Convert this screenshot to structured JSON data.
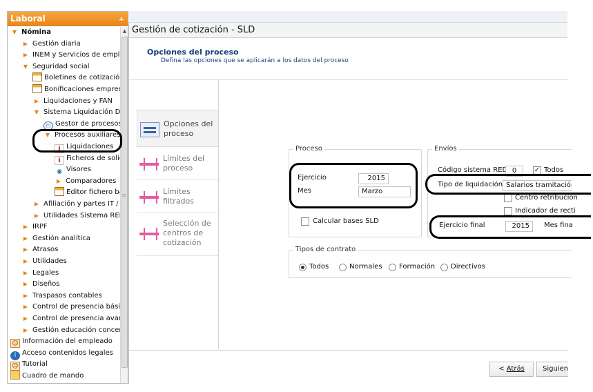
{
  "nav": {
    "title": "Laboral",
    "items": [
      {
        "label": "Nómina",
        "level": 0,
        "expander": "open",
        "icon": "",
        "bold": true
      },
      {
        "label": "Gestión diaria",
        "level": 1,
        "expander": "closed",
        "icon": ""
      },
      {
        "label": "INEM y Servicios de empleo",
        "level": 1,
        "expander": "closed",
        "icon": ""
      },
      {
        "label": "Seguridad social",
        "level": 1,
        "expander": "open",
        "icon": ""
      },
      {
        "label": "Boletines de cotización T",
        "level": 2,
        "expander": "",
        "icon": "grid"
      },
      {
        "label": "Bonificaciones empresa",
        "level": 2,
        "expander": "",
        "icon": "grid"
      },
      {
        "label": "Liquidaciones y FAN",
        "level": 2,
        "expander": "closed",
        "icon": ""
      },
      {
        "label": "Sistema Liquidación Dire",
        "level": 2,
        "expander": "open",
        "icon": ""
      },
      {
        "label": "Gestor de procesos",
        "level": 3,
        "expander": "",
        "icon": "clock"
      },
      {
        "label": "Procesos auxiliares",
        "level": 3,
        "expander": "open",
        "icon": ""
      },
      {
        "label": "Liquidaciones",
        "level": 4,
        "expander": "",
        "icon": "info"
      },
      {
        "label": "Ficheros de solic",
        "level": 4,
        "expander": "",
        "icon": "info"
      },
      {
        "label": "Visores",
        "level": 4,
        "expander": "",
        "icon": "eye"
      },
      {
        "label": "Comparadores",
        "level": 4,
        "expander": "closed",
        "icon": ""
      },
      {
        "label": "Editor fichero ba",
        "level": 4,
        "expander": "",
        "icon": "grid"
      },
      {
        "label": "Afiliación y partes IT / A",
        "level": 2,
        "expander": "closed",
        "icon": ""
      },
      {
        "label": "Utilidades Sistema RED",
        "level": 2,
        "expander": "closed",
        "icon": ""
      },
      {
        "label": "IRPF",
        "level": 1,
        "expander": "closed",
        "icon": ""
      },
      {
        "label": "Gestión analítica",
        "level": 1,
        "expander": "closed",
        "icon": ""
      },
      {
        "label": "Atrasos",
        "level": 1,
        "expander": "closed",
        "icon": ""
      },
      {
        "label": "Utilidades",
        "level": 1,
        "expander": "closed",
        "icon": ""
      },
      {
        "label": "Legales",
        "level": 1,
        "expander": "closed",
        "icon": ""
      },
      {
        "label": "Diseños",
        "level": 1,
        "expander": "closed",
        "icon": ""
      },
      {
        "label": "Traspasos contables",
        "level": 1,
        "expander": "closed",
        "icon": ""
      },
      {
        "label": "Control de presencia básico",
        "level": 1,
        "expander": "closed",
        "icon": ""
      },
      {
        "label": "Control de presencia avanza",
        "level": 1,
        "expander": "closed",
        "icon": ""
      },
      {
        "label": "Gestión educación concertad",
        "level": 1,
        "expander": "closed",
        "icon": ""
      },
      {
        "label": "Información del empleado",
        "level": 0,
        "expander": "",
        "icon": "user"
      },
      {
        "label": "Acceso contenidos legales",
        "level": 0,
        "expander": "",
        "icon": "world"
      },
      {
        "label": "Tutorial",
        "level": 0,
        "expander": "",
        "icon": "user"
      },
      {
        "label": "Cuadro de mando",
        "level": 0,
        "expander": "",
        "icon": "folder"
      }
    ]
  },
  "main": {
    "title": "Gestión de cotización - SLD",
    "heading": "Opciones del proceso",
    "subheading": "Defina las opciones que se aplicarán a los datos del proceso"
  },
  "steps": [
    {
      "label_1": "Opciones del",
      "label_2": "proceso",
      "label_3": "",
      "icon": "options-icon",
      "active": true
    },
    {
      "label_1": "Límites del",
      "label_2": "proceso",
      "label_3": "",
      "icon": "range-icon",
      "active": false
    },
    {
      "label_1": "Límites",
      "label_2": "filtrados",
      "label_3": "",
      "icon": "range-icon",
      "active": false
    },
    {
      "label_1": "Selección de",
      "label_2": "centros de",
      "label_3": "cotización",
      "icon": "range-icon",
      "active": false
    }
  ],
  "proceso": {
    "title": "Proceso",
    "ejercicio_label": "Ejercicio",
    "ejercicio_value": "2015",
    "mes_label": "Mes",
    "mes_value": "Marzo",
    "calcular_label": "Calcular bases SLD",
    "calcular_checked": false
  },
  "envios": {
    "title": "Envíos",
    "codigo_label": "Código sistema RED",
    "codigo_value": "0",
    "todos_label": "Todos",
    "todos_checked": true,
    "tipo_label": "Tipo de liquidación",
    "tipo_value": "Salarios tramitación",
    "centro_label": "Centro retribucion",
    "indicador_label": "Indicador de recti",
    "ejercicio_final_label": "Ejercicio final",
    "ejercicio_final_value": "2015",
    "mes_final_label": "Mes fina"
  },
  "tipos_contrato": {
    "title": "Tipos de contrato",
    "options": [
      "Todos",
      "Normales",
      "Formación",
      "Directivos"
    ],
    "selected": "Todos"
  },
  "footer": {
    "back_prefix": "< ",
    "back_label": "Atrás",
    "next_label": "Siguiente"
  },
  "colors": {
    "nav_header": "#e7841a",
    "heading": "#163e7a",
    "annotation": "#000000"
  }
}
